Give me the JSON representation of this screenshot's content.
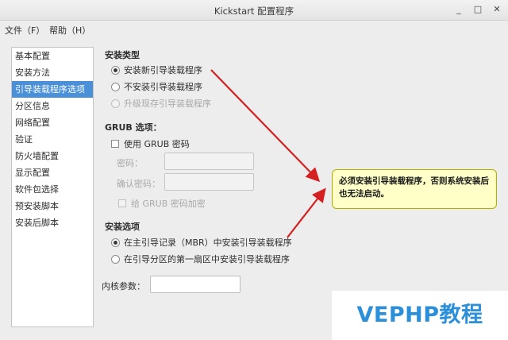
{
  "window": {
    "title": "Kickstart 配置程序",
    "minimize": "_",
    "maximize": "□",
    "close": "✕"
  },
  "menu": {
    "file": "文件（F）",
    "help": "帮助（H）"
  },
  "sidebar": {
    "items": [
      {
        "label": "基本配置"
      },
      {
        "label": "安装方法"
      },
      {
        "label": "引导装载程序选项"
      },
      {
        "label": "分区信息"
      },
      {
        "label": "网络配置"
      },
      {
        "label": "验证"
      },
      {
        "label": "防火墙配置"
      },
      {
        "label": "显示配置"
      },
      {
        "label": "软件包选择"
      },
      {
        "label": "预安装脚本"
      },
      {
        "label": "安装后脚本"
      }
    ],
    "selected_index": 2
  },
  "install_type": {
    "title": "安装类型",
    "options": [
      {
        "label": "安装新引导装载程序",
        "checked": true,
        "disabled": false
      },
      {
        "label": "不安装引导装载程序",
        "checked": false,
        "disabled": false
      },
      {
        "label": "升级现存引导装载程序",
        "checked": false,
        "disabled": true
      }
    ]
  },
  "grub": {
    "title": "GRUB 选项：",
    "use_password_label": "使用  GRUB 密码",
    "password_label": "密码：",
    "confirm_label": "确认密码：",
    "encrypt_label": "给  GRUB 密码加密"
  },
  "install_options": {
    "title": "安装选项",
    "options": [
      {
        "label": "在主引导记录（MBR）中安装引导装载程序",
        "checked": true
      },
      {
        "label": "在引导分区的第一扇区中安装引导装载程序",
        "checked": false
      }
    ]
  },
  "kernel": {
    "label": "内核参数：",
    "value": ""
  },
  "callout": {
    "text": "必须安装引导装载程序，否则系统安装后也无法启动。"
  },
  "watermark": {
    "text": "VEPHP教程"
  },
  "colors": {
    "selection": "#4a90d9",
    "arrow": "#d42020",
    "callout_bg": "#ffffc8",
    "watermark": "#2b8fd9"
  }
}
